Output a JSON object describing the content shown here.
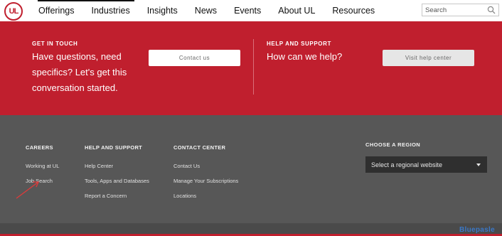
{
  "header": {
    "logo_text": "UL",
    "nav": [
      "Offerings",
      "Industries",
      "Insights",
      "News",
      "Events",
      "About UL",
      "Resources"
    ],
    "search_placeholder": "Search"
  },
  "banner": {
    "left": {
      "kicker": "GET IN TOUCH",
      "text": "Have questions, need specifics? Let's get this conversation started.",
      "button": "Contact us"
    },
    "right": {
      "kicker": "HELP AND SUPPORT",
      "text": "How can we help?",
      "button": "Visit help center"
    },
    "color": "#c01f2e"
  },
  "footer": {
    "columns": [
      {
        "title": "CAREERS",
        "links": [
          "Working at UL",
          "Job Search"
        ]
      },
      {
        "title": "HELP AND SUPPORT",
        "links": [
          "Help Center",
          "Tools, Apps and Databases",
          "Report a Concern"
        ]
      },
      {
        "title": "CONTACT CENTER",
        "links": [
          "Contact Us",
          "Manage Your Subscriptions",
          "Locations"
        ]
      }
    ],
    "region": {
      "title": "CHOOSE A REGION",
      "select_value": "Select a regional website"
    },
    "color": "#575757"
  },
  "watermark": "Bluepasle"
}
